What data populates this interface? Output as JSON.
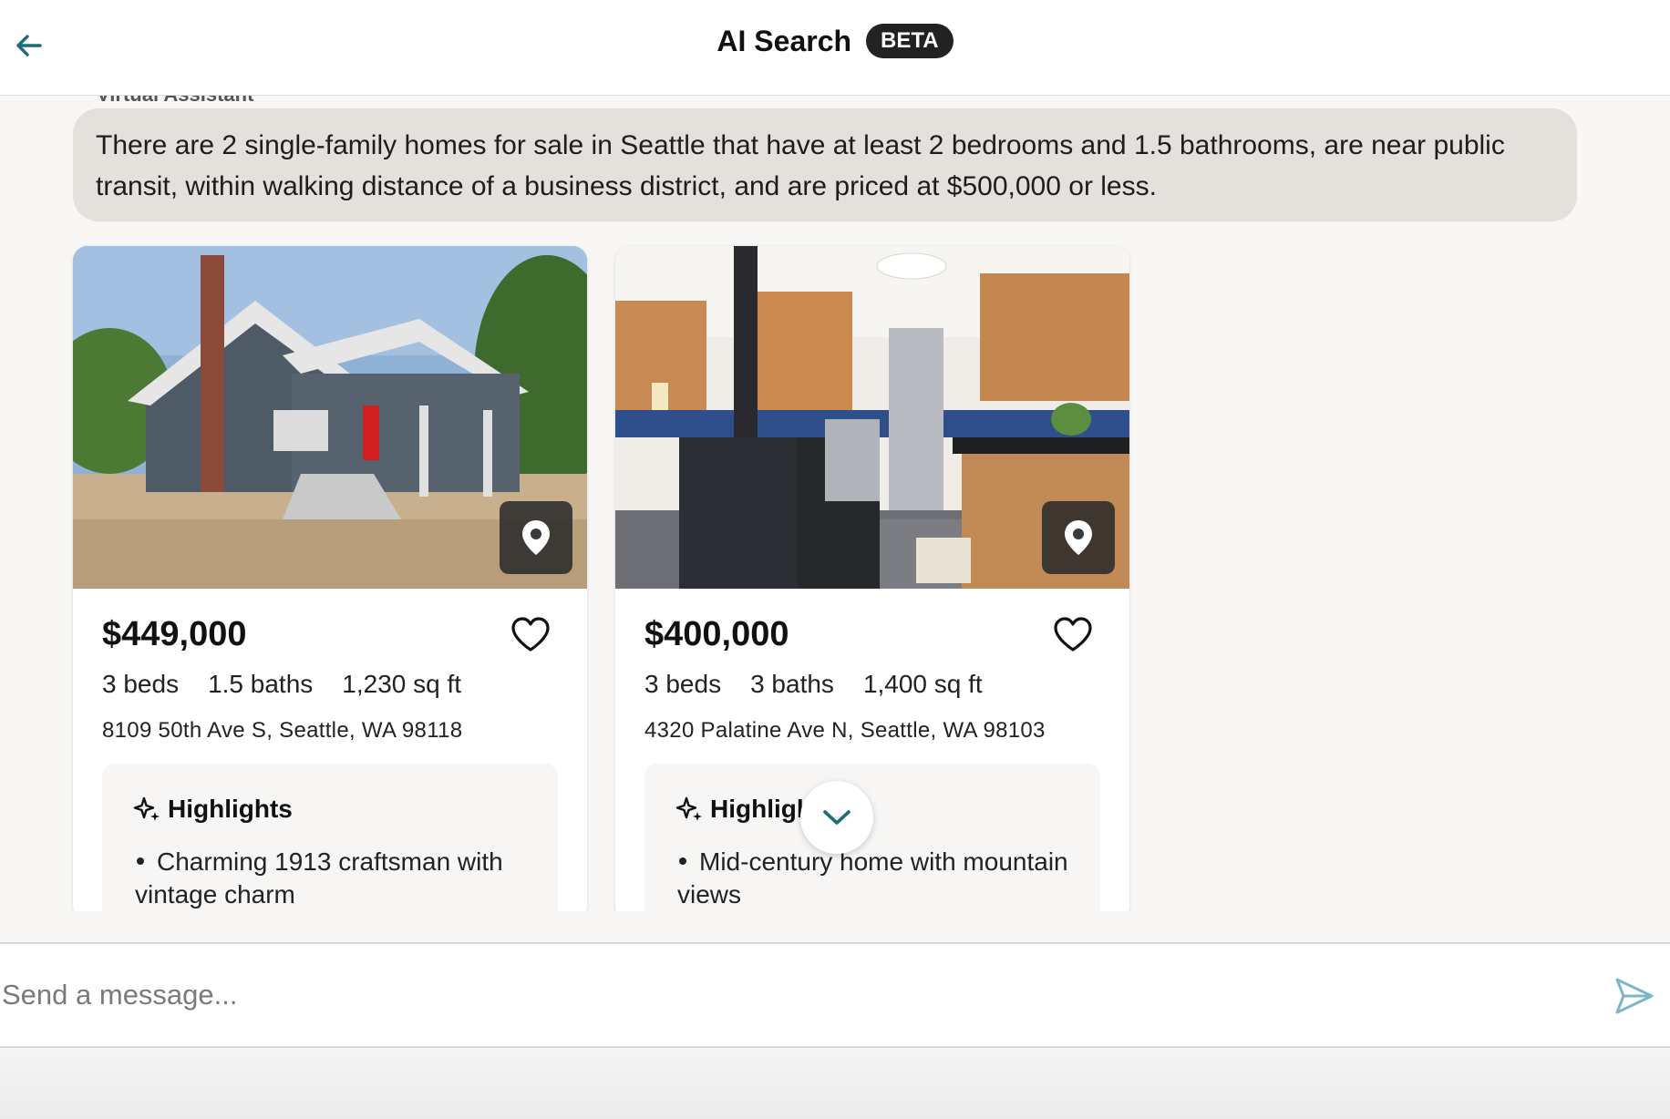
{
  "header": {
    "title": "AI Search",
    "badge": "BETA"
  },
  "chat": {
    "assistant_message": "There are 2 single-family homes for sale in Seattle that have at least 2 bedrooms and 1.5 bathrooms, are near public transit, within walking distance of a business district, and are priced at $500,000 or less."
  },
  "listings": [
    {
      "price": "$449,000",
      "beds": "3 beds",
      "baths": "1.5 baths",
      "sqft": "1,230 sq ft",
      "address": "8109 50th Ave S, Seattle, WA 98118",
      "highlights_title": "Highlights",
      "highlight": "Charming 1913 craftsman with vintage charm"
    },
    {
      "price": "$400,000",
      "beds": "3 beds",
      "baths": "3 baths",
      "sqft": "1,400 sq ft",
      "address": "4320 Palatine Ave N, Seattle, WA 98103",
      "highlights_title": "Highlights",
      "highlight": "Mid-century home with mountain views"
    }
  ],
  "composer": {
    "placeholder": "Send a message..."
  },
  "colors": {
    "accent": "#1e6b7a",
    "bubble_bg": "#e4e0db",
    "badge_bg": "#222222"
  },
  "icons": [
    "arrow-left-icon",
    "map-pin-icon",
    "heart-icon",
    "sparkle-icon",
    "chevron-down-icon",
    "send-icon"
  ]
}
